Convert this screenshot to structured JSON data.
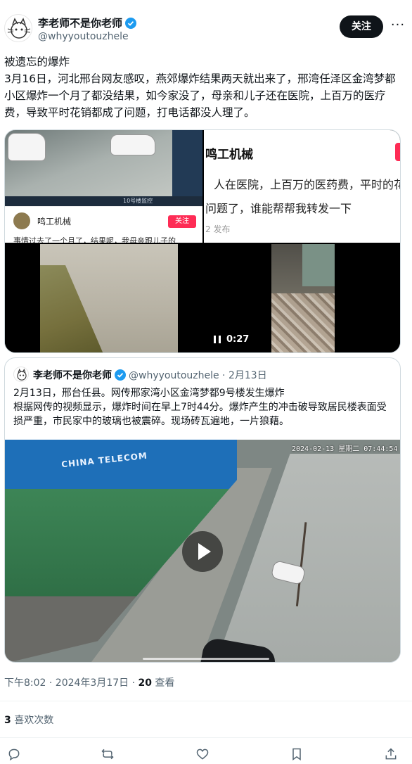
{
  "author": {
    "name": "李老师不是你老师",
    "handle": "@whyyoutouzhele",
    "follow_label": "关注",
    "more_label": "···"
  },
  "tweet": {
    "lines": [
      "被遗忘的爆炸",
      "3月16日，河北邢台网友感叹，燕郊爆炸结果两天就出来了，邢湾任泽区金湾梦都小区爆炸一个月了都没结果，如今家没了，母亲和儿子还在医院，上百万的医疗费，导致平时花销都成了问题，打电话都没人理了。"
    ]
  },
  "media": {
    "c1": {
      "account_name": "鸣工机械",
      "follow_label": "关注",
      "caption": "事情过去了一个月了，结果呢，我母亲跟儿子的",
      "cam_label": "10号楼监控"
    },
    "c2": {
      "title": "鸣工机械",
      "line1": "人在医院，上百万的医药费，平时的花",
      "line2": "问题了，谁能帮帮我转发一下",
      "meta": "2 发布"
    },
    "c4": {
      "duration": "0:27"
    }
  },
  "quote": {
    "name": "李老师不是你老师",
    "handle": "@whyyoutouzhele · 2月13日",
    "lines": [
      "2月13日，邢台任县。网传邢家湾小区金湾梦都9号楼发生爆炸",
      " 根据网传的视频显示，爆炸时间在早上7时44分。爆炸产生的冲击破导致居民楼表面受损严重，市民家中的玻璃也被震碎。现场砖瓦遍地，一片狼藉。"
    ],
    "video": {
      "brand": "CHINA TELECOM",
      "timestamp": "2024-02-13 星期二 07:44:54"
    }
  },
  "meta": {
    "time": "下午8:02 · 2024年3月17日 · ",
    "views_count": "20",
    "views_label": " 查看"
  },
  "likes": {
    "count": "3",
    "label": " 喜欢次数"
  },
  "actions": {
    "reply": "reply-icon",
    "retweet": "retweet-icon",
    "like": "like-icon",
    "bookmark": "bookmark-icon",
    "share": "share-icon"
  }
}
